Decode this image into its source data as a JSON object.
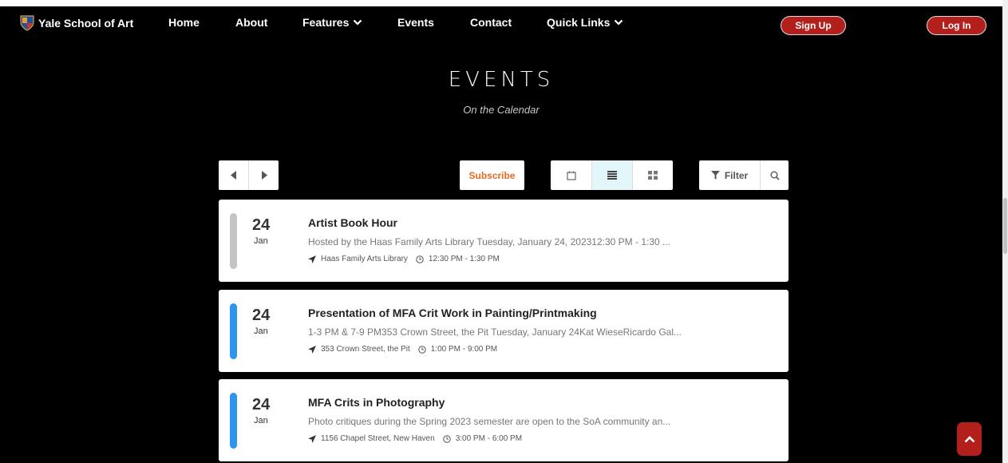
{
  "nav": {
    "brand": "Yale School of Art",
    "items": [
      "Home",
      "About",
      "Features",
      "Events",
      "Contact",
      "Quick Links"
    ],
    "signup": "Sign Up",
    "login": "Log In"
  },
  "hero": {
    "title": "EVENTS",
    "subtitle": "On the Calendar"
  },
  "toolbar": {
    "subscribe": "Subscribe",
    "filter": "Filter",
    "active_view": "list"
  },
  "events": [
    {
      "day": "24",
      "month": "Jan",
      "title": "Artist Book Hour",
      "description": "Hosted by the Haas Family Arts Library Tuesday, January 24, 202312:30 PM - 1:30 ...",
      "location": "Haas Family Arts Library",
      "time": "12:30 PM - 1:30 PM",
      "color": "#c4c4c4"
    },
    {
      "day": "24",
      "month": "Jan",
      "title": "Presentation of MFA Crit Work in Painting/Printmaking",
      "description": "1-3 PM & 7-9 PM353 Crown Street, the Pit Tuesday, January 24Kat WieseRicardo Gal...",
      "location": "353 Crown Street, the Pit",
      "time": "1:00 PM - 9:00 PM",
      "color": "#2d95ee"
    },
    {
      "day": "24",
      "month": "Jan",
      "title": "MFA Crits in Photography",
      "description": "Photo critiques during the Spring 2023 semester are open to the SoA community an...",
      "location": "1156 Chapel Street, New Haven",
      "time": "3:00 PM - 6:00 PM",
      "color": "#2d95ee"
    }
  ],
  "colors": {
    "accent_red": "#b3201c",
    "subscribe_orange": "#e56b1f",
    "active_view_bg": "#e3f7fb"
  }
}
